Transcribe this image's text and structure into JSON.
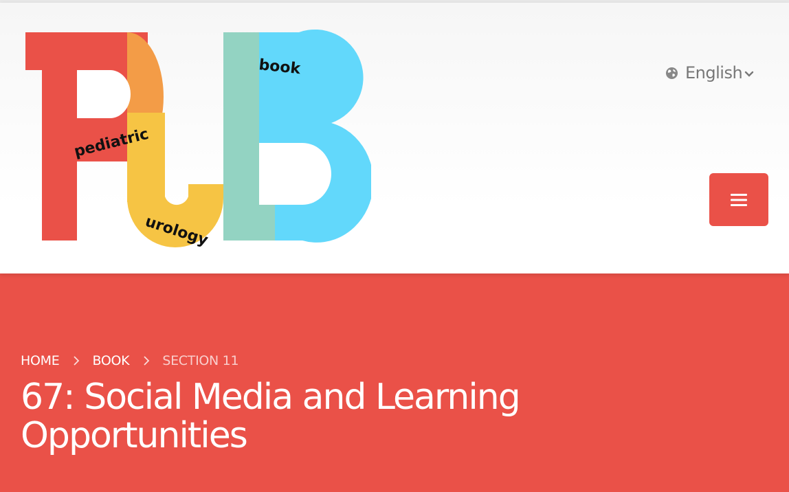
{
  "logo": {
    "main_letters": "PUB",
    "word_pediatric": "pediatric",
    "word_urology": "urology",
    "word_book": "book",
    "colors": {
      "red": "#ea5148",
      "orange": "#f39c47",
      "yellow": "#f6c444",
      "green": "#93d3c2",
      "blue": "#62d8fb"
    }
  },
  "header": {
    "language_label": "English",
    "language_icon": "globe-icon",
    "language_caret_icon": "chevron-down-icon",
    "menu_icon": "hamburger-icon",
    "accent_color": "#ea5148"
  },
  "breadcrumb": {
    "items": [
      {
        "label": "HOME"
      },
      {
        "label": "BOOK"
      },
      {
        "label": "SECTION 11"
      }
    ],
    "separator_icon": "chevron-right-icon"
  },
  "page": {
    "title": "67: Social Media and Learning Opportunities"
  }
}
